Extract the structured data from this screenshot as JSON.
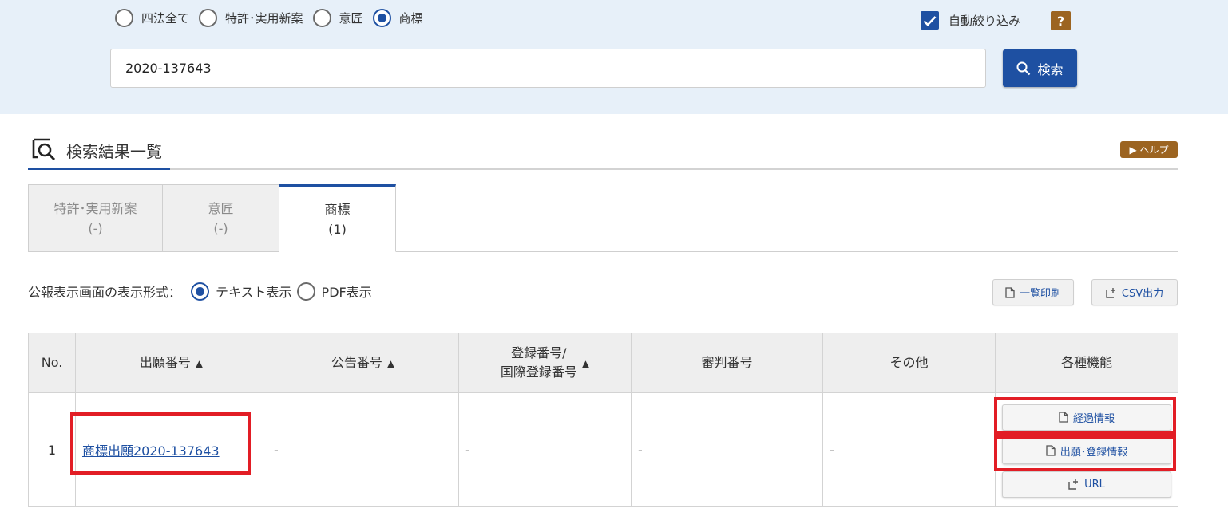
{
  "search": {
    "radio_options": [
      {
        "label": "四法全て",
        "checked": false
      },
      {
        "label": "特許･実用新案",
        "checked": false
      },
      {
        "label": "意匠",
        "checked": false
      },
      {
        "label": "商標",
        "checked": true
      }
    ],
    "auto_filter_label": "自動絞り込み",
    "auto_filter_checked": true,
    "help_symbol": "?",
    "query_value": "2020-137643",
    "search_button_label": "検索"
  },
  "results": {
    "title": "検索結果一覧",
    "help_label": "▶ ヘルプ",
    "tabs": [
      {
        "label": "特許･実用新案",
        "count": "(-)",
        "active": false
      },
      {
        "label": "意匠",
        "count": "(-)",
        "active": false
      },
      {
        "label": "商標",
        "count": "(1)",
        "active": true
      }
    ],
    "format_label": "公報表示画面の表示形式：",
    "format_options": [
      {
        "label": "テキスト表示",
        "checked": true
      },
      {
        "label": "PDF表示",
        "checked": false
      }
    ],
    "print_label": "一覧印刷",
    "csv_label": "CSV出力",
    "columns": {
      "no": "No.",
      "application": "出願番号",
      "publication": "公告番号",
      "registration_1": "登録番号/",
      "registration_2": "国際登録番号",
      "trial": "審判番号",
      "other": "その他",
      "functions": "各種機能"
    },
    "sort_arrow": "▲",
    "rows": [
      {
        "no": "1",
        "application": "商標出願2020-137643",
        "publication": "-",
        "registration": "-",
        "trial": "-",
        "other": "-",
        "functions": [
          "経過情報",
          "出願･登録情報",
          "URL"
        ]
      }
    ]
  },
  "colors": {
    "accent": "#1e50a2",
    "band_bg": "#e7f0f9",
    "help_brown": "#9c6421",
    "highlight_red": "#e21d25"
  },
  "icons": [
    "search-icon",
    "check-icon",
    "help-icon",
    "magnifier-list-icon",
    "document-icon",
    "export-icon"
  ]
}
